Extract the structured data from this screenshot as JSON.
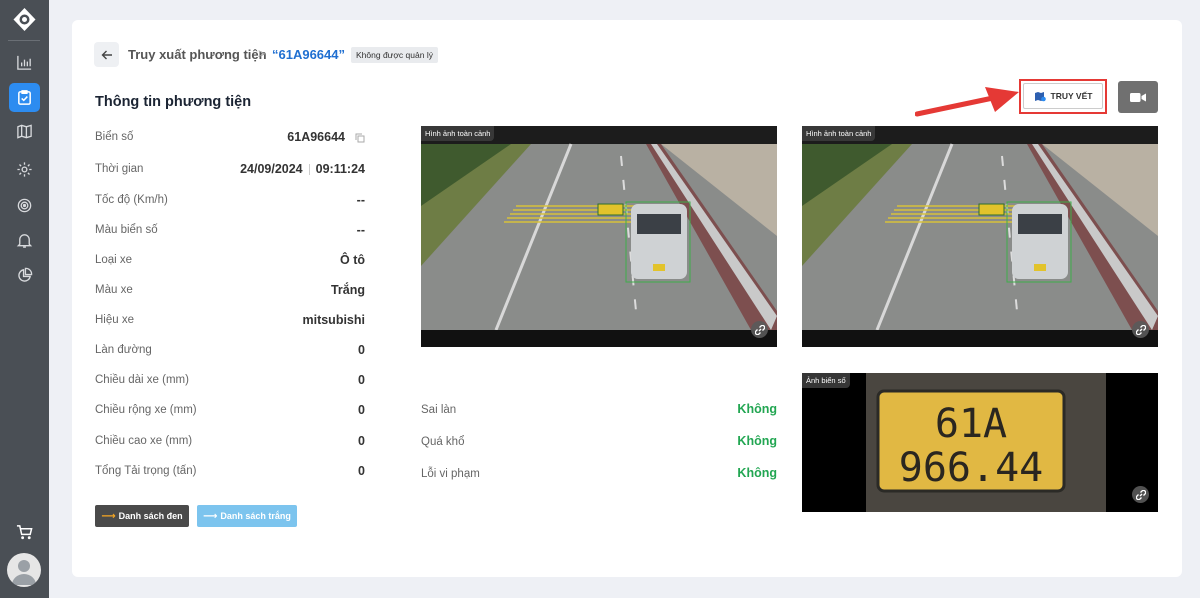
{
  "breadcrumb": {
    "parent": "Truy xuất phương tiện",
    "separator": ">",
    "current": "“61A96644”",
    "status_badge": "Không được quản lý"
  },
  "section_title": "Thông tin phương tiện",
  "info": [
    {
      "label": "Biển số",
      "value": "61A96644"
    },
    {
      "label": "Thời gian",
      "date": "24/09/2024",
      "time": "09:11:24"
    },
    {
      "label": "Tốc độ (Km/h)",
      "value": "--"
    },
    {
      "label": "Màu biển số",
      "value": "--"
    },
    {
      "label": "Loại xe",
      "value": "Ô tô"
    },
    {
      "label": "Màu xe",
      "value": "Trắng"
    },
    {
      "label": "Hiệu xe",
      "value": "mitsubishi"
    },
    {
      "label": "Làn đường",
      "value": "0"
    },
    {
      "label": "Chiều dài xe (mm)",
      "value": "0"
    },
    {
      "label": "Chiều rộng xe (mm)",
      "value": "0"
    },
    {
      "label": "Chiều cao xe (mm)",
      "value": "0"
    },
    {
      "label": "Tổng Tải trọng (tấn)",
      "value": "0"
    }
  ],
  "buttons": {
    "blacklist": "Danh sách đen",
    "whitelist": "Danh sách trắng",
    "trace": "TRUY VẾT"
  },
  "images": {
    "overview_tag_1": "Hình ảnh toàn cảnh",
    "overview_tag_2": "Hình ảnh toàn cảnh",
    "plate_tag": "Ảnh biển số",
    "plate_line_1": "61A",
    "plate_line_2": "966.44"
  },
  "violations": [
    {
      "label": "Sai làn",
      "value": "Không"
    },
    {
      "label": "Quá khổ",
      "value": "Không"
    },
    {
      "label": "Lỗi vi phạm",
      "value": "Không"
    }
  ],
  "colors": {
    "sidebar_bg": "#4a4f55",
    "accent_blue": "#2d8cf0",
    "status_green": "#22a652",
    "highlight_red": "#e53935"
  }
}
